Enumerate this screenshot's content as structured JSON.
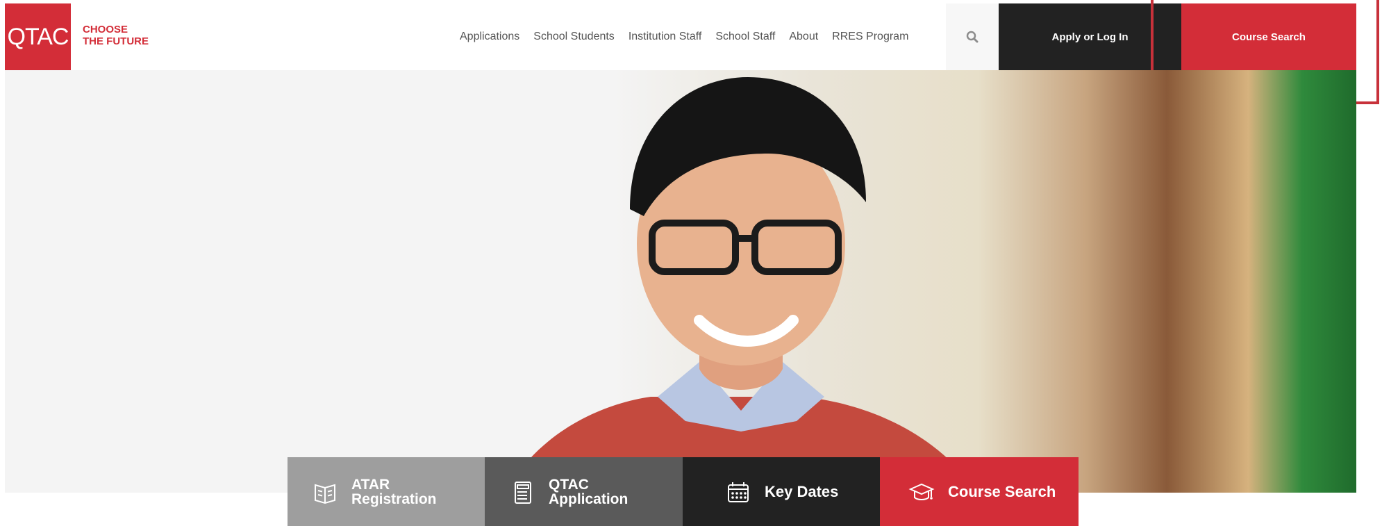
{
  "header": {
    "logo_text": "QTAC",
    "tagline_line1": "CHOOSE",
    "tagline_line2": "THE FUTURE",
    "nav": [
      {
        "label": "Applications"
      },
      {
        "label": "School Students"
      },
      {
        "label": "Institution Staff"
      },
      {
        "label": "School Staff"
      },
      {
        "label": "About"
      },
      {
        "label": "RRES Program"
      }
    ],
    "search_icon": "search-icon",
    "apply_label": "Apply or Log In",
    "course_search_label": "Course Search"
  },
  "tiles": [
    {
      "name": "atar-registration",
      "line1": "ATAR",
      "line2": "Registration",
      "icon": "book-icon"
    },
    {
      "name": "qtac-application",
      "line1": "QTAC",
      "line2": "Application",
      "icon": "document-icon"
    },
    {
      "name": "key-dates",
      "label": "Key Dates",
      "icon": "calendar-icon"
    },
    {
      "name": "course-search",
      "label": "Course Search",
      "icon": "graduation-cap-icon"
    }
  ],
  "colors": {
    "brand_red": "#d32d38",
    "dark": "#222222",
    "tile_grey": "#9e9e9e",
    "tile_mid": "#5a5a5a"
  }
}
